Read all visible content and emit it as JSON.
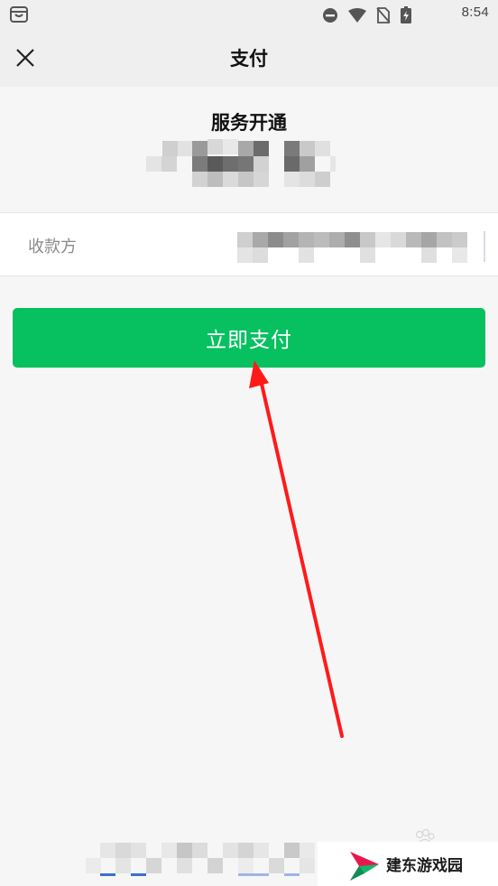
{
  "status_bar": {
    "time": "8:54",
    "icons": [
      "app-bag-icon",
      "do-not-disturb-icon",
      "wifi-icon",
      "no-sim-icon",
      "battery-icon"
    ]
  },
  "nav": {
    "title": "支付",
    "close_icon": "close-icon"
  },
  "summary": {
    "service_title": "服务开通",
    "amount_redacted": true
  },
  "payee": {
    "label": "收款方",
    "value_redacted": true
  },
  "pay_button": {
    "label": "立即支付",
    "color": "#07c160"
  },
  "annotation": {
    "arrow_color": "#ff1a1a"
  },
  "watermark": {
    "text": "建东游戏园"
  }
}
